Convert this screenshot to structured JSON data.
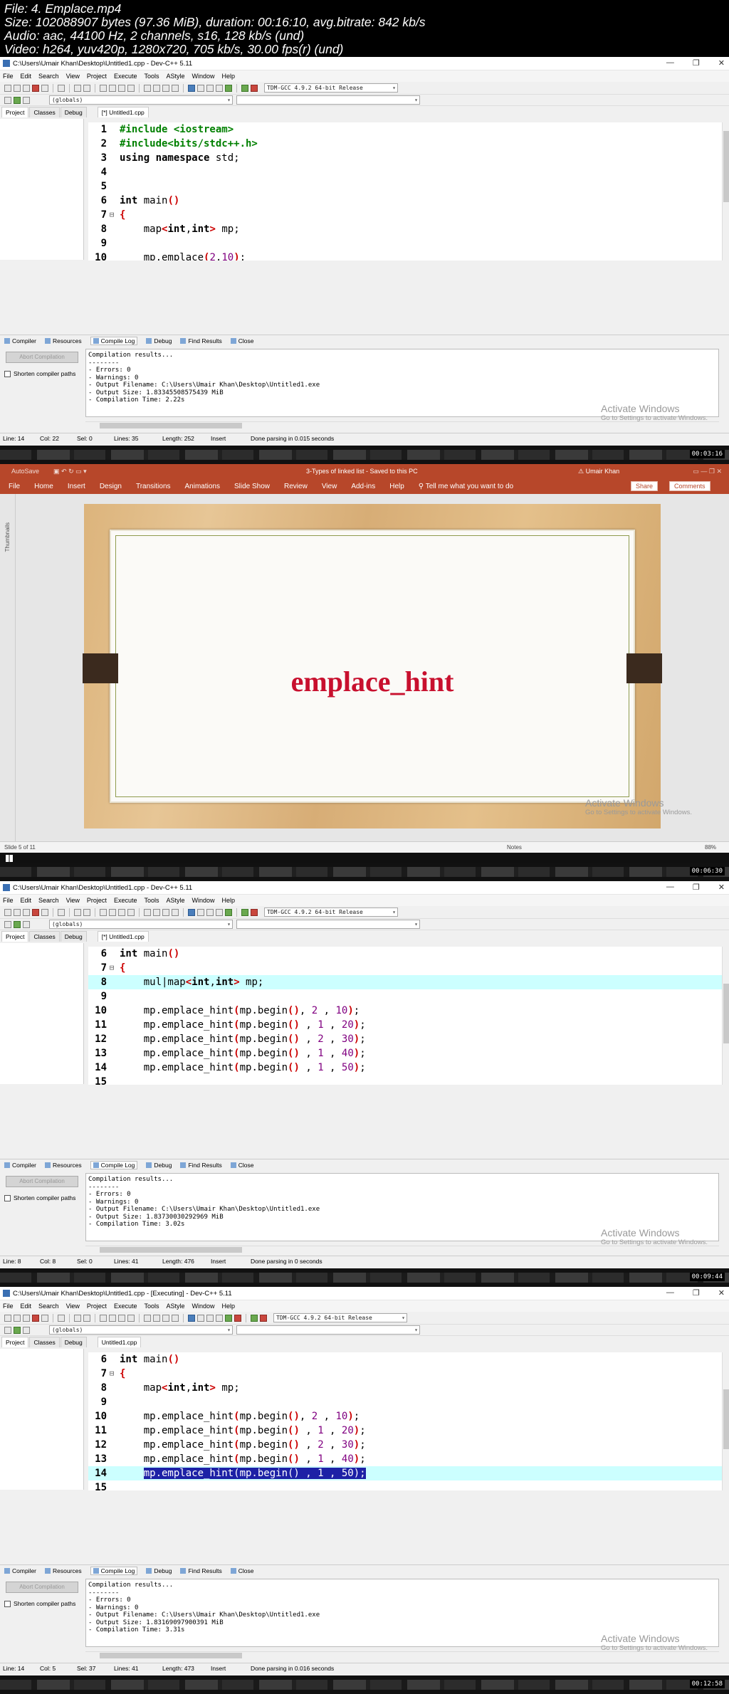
{
  "header": {
    "file": "File: 4. Emplace.mp4",
    "size": "Size: 102088907 bytes (97.36 MiB), duration: 00:16:10, avg.bitrate: 842 kb/s",
    "audio": "Audio: aac, 44100 Hz, 2 channels, s16, 128 kb/s (und)",
    "video": "Video: h264, yuv420p, 1280x720, 705 kb/s, 30.00 fps(r) (und)"
  },
  "timestamps": [
    "00:03:16",
    "00:06:30",
    "00:09:44",
    "00:12:58"
  ],
  "devcpp": {
    "menu": [
      "File",
      "Edit",
      "Search",
      "View",
      "Project",
      "Execute",
      "Tools",
      "AStyle",
      "Window",
      "Help"
    ],
    "compiler_combo": "TDM-GCC 4.9.2 64-bit Release",
    "globals_combo": "(globals)",
    "left_tabs": [
      "Project",
      "Classes",
      "Debug"
    ],
    "bottom_tabs": [
      "Compiler",
      "Resources",
      "Compile Log",
      "Debug",
      "Find Results",
      "Close"
    ],
    "abort_label": "Abort Compilation",
    "shorten_label": "Shorten compiler paths",
    "activate_title": "Activate Windows",
    "activate_sub": "Go to Settings to activate Windows."
  },
  "frame1": {
    "title": "C:\\Users\\Umair Khan\\Desktop\\Untitled1.cpp - Dev-C++ 5.11",
    "file_tab": "[*] Untitled1.cpp",
    "log": "Compilation results...\n--------\n- Errors: 0\n- Warnings: 0\n- Output Filename: C:\\Users\\Umair Khan\\Desktop\\Untitled1.exe\n- Output Size: 1.83345508575439 MiB\n- Compilation Time: 2.22s",
    "status": {
      "line": "Line:    14",
      "col": "Col:    22",
      "sel": "Sel:     0",
      "lines": "Lines:    35",
      "length": "Length:    252",
      "mode": "Insert",
      "msg": "Done parsing in 0.015 seconds"
    }
  },
  "ppt": {
    "autosave": "AutoSave",
    "title": "3-Types of linked list  -  Saved to this PC",
    "user": "Umair Khan",
    "menu": [
      "File",
      "Home",
      "Insert",
      "Design",
      "Transitions",
      "Animations",
      "Slide Show",
      "Review",
      "View",
      "Add-ins",
      "Help"
    ],
    "tell_me": "Tell me what you want to do",
    "share": "Share",
    "comments": "Comments",
    "thumbnails": "Thumbnails",
    "slide_title": "emplace_hint",
    "slide_num": "Slide 5 of 11",
    "notes": "Notes",
    "zoom": "88%"
  },
  "frame3": {
    "title": "C:\\Users\\Umair Khan\\Desktop\\Untitled1.cpp - Dev-C++ 5.11",
    "file_tab": "[*] Untitled1.cpp",
    "log": "Compilation results...\n--------\n- Errors: 0\n- Warnings: 0\n- Output Filename: C:\\Users\\Umair Khan\\Desktop\\Untitled1.exe\n- Output Size: 1.83730030292969 MiB\n- Compilation Time: 3.02s",
    "status": {
      "line": "Line:    8",
      "col": "Col:    8",
      "sel": "Sel:     0",
      "lines": "Lines:    41",
      "length": "Length:    476",
      "mode": "Insert",
      "msg": "Done parsing in 0 seconds"
    }
  },
  "frame4": {
    "title": "C:\\Users\\Umair Khan\\Desktop\\Untitled1.cpp - [Executing] - Dev-C++ 5.11",
    "file_tab": "Untitled1.cpp",
    "log": "Compilation results...\n--------\n- Errors: 0\n- Warnings: 0\n- Output Filename: C:\\Users\\Umair Khan\\Desktop\\Untitled1.exe\n- Output Size: 1.83169097900391 MiB\n- Compilation Time: 3.31s",
    "status": {
      "line": "Line:    14",
      "col": "Col:    5",
      "sel": "Sel:    37",
      "lines": "Lines:    41",
      "length": "Length:    473",
      "mode": "Insert",
      "msg": "Done parsing in 0.016 seconds"
    }
  }
}
